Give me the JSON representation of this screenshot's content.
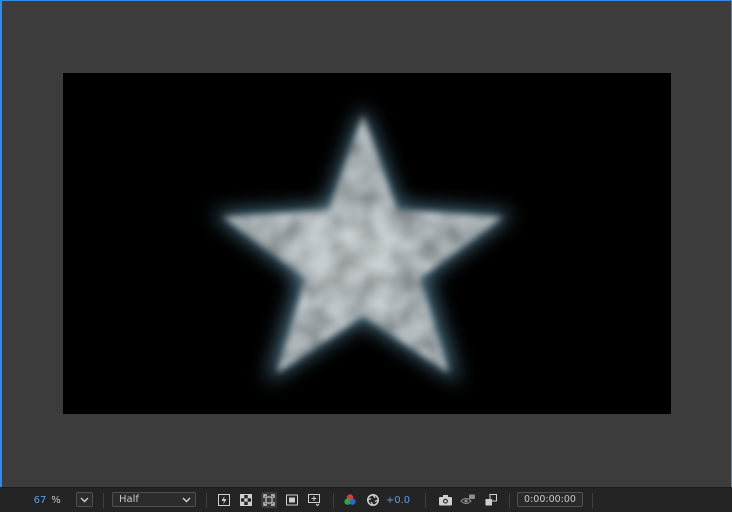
{
  "toolbar": {
    "zoom_value": "67",
    "zoom_unit": "%",
    "resolution": "Half",
    "exposure": "+0.0",
    "timecode": "0:00:00:00"
  },
  "icons": [
    "zoom-menu-chevron-icon",
    "fast-previews-icon",
    "transparency-grid-icon",
    "region-of-interest-icon",
    "safe-margins-icon",
    "view-options-icon",
    "channel-color-icon",
    "reset-exposure-icon",
    "snapshot-camera-icon",
    "show-snapshot-icon",
    "show-channel-icon"
  ],
  "colors": {
    "accent_blue": "#2d8ceb",
    "value_blue": "#5a9fe8",
    "panel_bg": "#3c3c3c",
    "toolbar_bg": "#242424",
    "comp_bg": "#000000"
  }
}
